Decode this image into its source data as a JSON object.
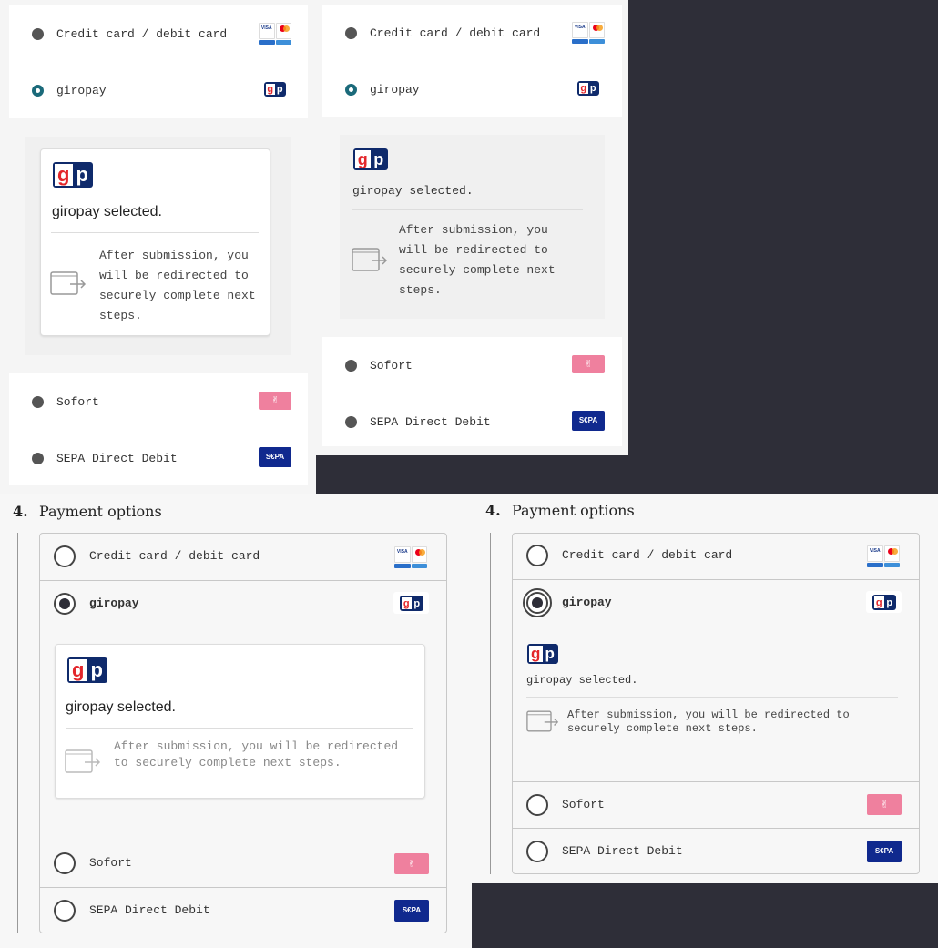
{
  "payment": {
    "credit": "Credit card / debit card",
    "giropay": "giropay",
    "sofort": "Sofort",
    "sepa": "SEPA Direct Debit",
    "selected": "giropay selected.",
    "redirect": "After submission, you will be redirected to securely complete next steps."
  },
  "section": {
    "number": "4.",
    "title": "Payment options"
  },
  "icons": {
    "gp_g": "g",
    "gp_p": "p",
    "visa": "VISA",
    "sepa": "S€PA",
    "sofort": "✌"
  },
  "colors": {
    "accent": "#1b6a7a",
    "giropay": "#0f2a6b",
    "sofort": "#ef809e",
    "sepa": "#10298e",
    "dark": "#2e2e38"
  }
}
